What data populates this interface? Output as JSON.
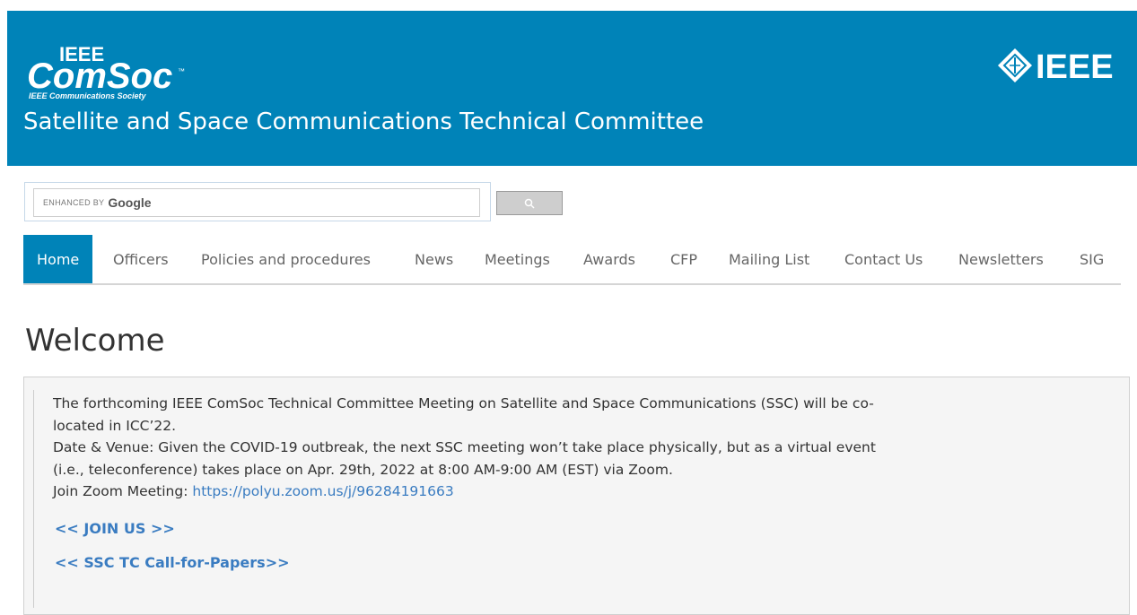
{
  "header": {
    "title": "Satellite and Space Communications Technical Committee",
    "comsoc_logo": {
      "top": "IEEE",
      "main": "ComSoc",
      "tm": "™",
      "sub": "IEEE Communications Society"
    },
    "ieee_logo": "IEEE",
    "colors": {
      "brand": "#0083b8"
    }
  },
  "search": {
    "placeholder_prefix": "ENHANCED BY",
    "placeholder_brand": "Google",
    "button_icon": "search-icon"
  },
  "nav": {
    "items": [
      {
        "label": "Home",
        "active": true
      },
      {
        "label": "Officers"
      },
      {
        "label": "Policies and procedures"
      },
      {
        "label": "News"
      },
      {
        "label": "Meetings"
      },
      {
        "label": "Awards"
      },
      {
        "label": "CFP"
      },
      {
        "label": "Mailing List"
      },
      {
        "label": "Contact Us"
      },
      {
        "label": "Newsletters"
      },
      {
        "label": "SIG"
      }
    ]
  },
  "main": {
    "heading": "Welcome",
    "notice": {
      "line1": "The forthcoming IEEE ComSoc Technical Committee Meeting on Satellite and Space Communications (SSC) will be co-",
      "line2": "located in ICC’22.",
      "line3": "Date & Venue: Given the COVID-19 outbreak, the next SSC meeting won’t take place physically, but as a virtual event",
      "line4": "(i.e., teleconference) takes place on Apr. 29th, 2022 at 8:00 AM-9:00 AM (EST) via Zoom.",
      "zoom_label": "Join Zoom Meeting: ",
      "zoom_link": "https://polyu.zoom.us/j/96284191663",
      "join_link": "<< JOIN US >>",
      "cfp_link": "<< SSC TC Call-for-Papers>>"
    }
  }
}
